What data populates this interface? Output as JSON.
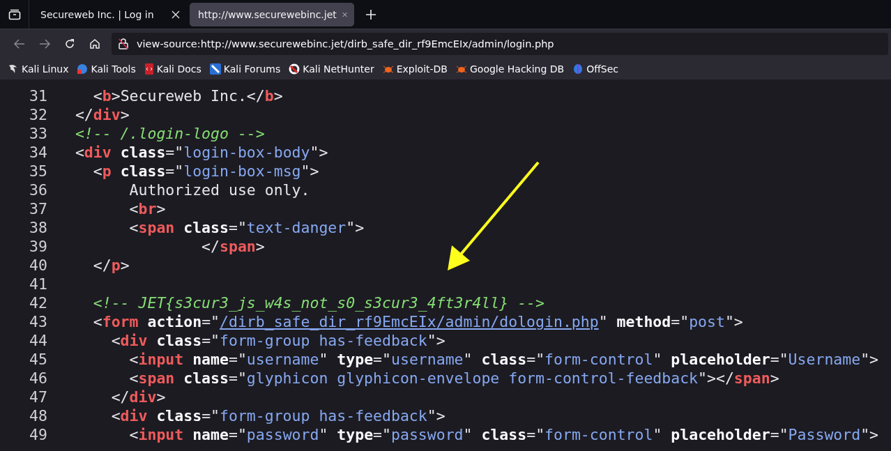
{
  "tabs": [
    {
      "title": "Secureweb Inc. | Log in",
      "selected": false
    },
    {
      "title": "http://www.securewebinc.jet",
      "selected": true
    }
  ],
  "address_bar": {
    "value": "view-source:http://www.securewebinc.jet/dirb_safe_dir_rf9EmcEIx/admin/login.php"
  },
  "bookmarks": [
    {
      "label": "Kali Linux",
      "kind": "dragon"
    },
    {
      "label": "Kali Tools",
      "kind": "tools"
    },
    {
      "label": "Kali Docs",
      "kind": "docs"
    },
    {
      "label": "Kali Forums",
      "kind": "forums"
    },
    {
      "label": "Kali NetHunter",
      "kind": "nethunter"
    },
    {
      "label": "Exploit-DB",
      "kind": "bug"
    },
    {
      "label": "Google Hacking DB",
      "kind": "bug"
    },
    {
      "label": "OffSec",
      "kind": "offsec"
    }
  ],
  "source_lines": [
    {
      "number": "31",
      "tokens": [
        {
          "kind": "plain",
          "text": "    <"
        },
        {
          "kind": "tag",
          "text": "b"
        },
        {
          "kind": "plain",
          "text": ">Secureweb Inc.</"
        },
        {
          "kind": "tag",
          "text": "b"
        },
        {
          "kind": "plain",
          "text": ">"
        }
      ]
    },
    {
      "number": "32",
      "tokens": [
        {
          "kind": "plain",
          "text": "  </"
        },
        {
          "kind": "tag",
          "text": "div"
        },
        {
          "kind": "plain",
          "text": ">"
        }
      ]
    },
    {
      "number": "33",
      "tokens": [
        {
          "kind": "comment",
          "text": "  <!-- /.login-logo -->"
        }
      ]
    },
    {
      "number": "34",
      "tokens": [
        {
          "kind": "plain",
          "text": "  <"
        },
        {
          "kind": "tag",
          "text": "div"
        },
        {
          "kind": "attr",
          "text": " class"
        },
        {
          "kind": "plain",
          "text": "=\""
        },
        {
          "kind": "value",
          "text": "login-box-body"
        },
        {
          "kind": "plain",
          "text": "\">"
        }
      ]
    },
    {
      "number": "35",
      "tokens": [
        {
          "kind": "plain",
          "text": "    <"
        },
        {
          "kind": "tag",
          "text": "p"
        },
        {
          "kind": "attr",
          "text": " class"
        },
        {
          "kind": "plain",
          "text": "=\""
        },
        {
          "kind": "value",
          "text": "login-box-msg"
        },
        {
          "kind": "plain",
          "text": "\">"
        }
      ]
    },
    {
      "number": "36",
      "tokens": [
        {
          "kind": "plain",
          "text": "        Authorized use only."
        }
      ]
    },
    {
      "number": "37",
      "tokens": [
        {
          "kind": "plain",
          "text": "        <"
        },
        {
          "kind": "tag",
          "text": "br"
        },
        {
          "kind": "plain",
          "text": ">"
        }
      ]
    },
    {
      "number": "38",
      "tokens": [
        {
          "kind": "plain",
          "text": "        <"
        },
        {
          "kind": "tag",
          "text": "span"
        },
        {
          "kind": "attr",
          "text": " class"
        },
        {
          "kind": "plain",
          "text": "=\""
        },
        {
          "kind": "value",
          "text": "text-danger"
        },
        {
          "kind": "plain",
          "text": "\">"
        }
      ]
    },
    {
      "number": "39",
      "tokens": [
        {
          "kind": "plain",
          "text": "                </"
        },
        {
          "kind": "tag",
          "text": "span"
        },
        {
          "kind": "plain",
          "text": ">"
        }
      ]
    },
    {
      "number": "40",
      "tokens": [
        {
          "kind": "plain",
          "text": "    </"
        },
        {
          "kind": "tag",
          "text": "p"
        },
        {
          "kind": "plain",
          "text": ">"
        }
      ]
    },
    {
      "number": "41"
    },
    {
      "number": "42",
      "tokens": [
        {
          "kind": "comment",
          "text": "    <!-- JET{s3cur3_js_w4s_not_s0_s3cur3_4ft3r4ll} -->"
        }
      ]
    },
    {
      "number": "43",
      "tokens": [
        {
          "kind": "plain",
          "text": "    <"
        },
        {
          "kind": "tag",
          "text": "form"
        },
        {
          "kind": "attr",
          "text": " action"
        },
        {
          "kind": "plain",
          "text": "=\""
        },
        {
          "kind": "link",
          "text": "/dirb_safe_dir_rf9EmcEIx/admin/dologin.php"
        },
        {
          "kind": "plain",
          "text": "\""
        },
        {
          "kind": "attr",
          "text": " method"
        },
        {
          "kind": "plain",
          "text": "=\""
        },
        {
          "kind": "value",
          "text": "post"
        },
        {
          "kind": "plain",
          "text": "\">"
        }
      ]
    },
    {
      "number": "44",
      "tokens": [
        {
          "kind": "plain",
          "text": "      <"
        },
        {
          "kind": "tag",
          "text": "div"
        },
        {
          "kind": "attr",
          "text": " class"
        },
        {
          "kind": "plain",
          "text": "=\""
        },
        {
          "kind": "value",
          "text": "form-group has-feedback"
        },
        {
          "kind": "plain",
          "text": "\">"
        }
      ]
    },
    {
      "number": "45",
      "tokens": [
        {
          "kind": "plain",
          "text": "        <"
        },
        {
          "kind": "tag",
          "text": "input"
        },
        {
          "kind": "attr",
          "text": " name"
        },
        {
          "kind": "plain",
          "text": "=\""
        },
        {
          "kind": "value",
          "text": "username"
        },
        {
          "kind": "plain",
          "text": "\""
        },
        {
          "kind": "attr",
          "text": " type"
        },
        {
          "kind": "plain",
          "text": "=\""
        },
        {
          "kind": "value",
          "text": "username"
        },
        {
          "kind": "plain",
          "text": "\""
        },
        {
          "kind": "attr",
          "text": " class"
        },
        {
          "kind": "plain",
          "text": "=\""
        },
        {
          "kind": "value",
          "text": "form-control"
        },
        {
          "kind": "plain",
          "text": "\""
        },
        {
          "kind": "attr",
          "text": " placeholder"
        },
        {
          "kind": "plain",
          "text": "=\""
        },
        {
          "kind": "value",
          "text": "Username"
        },
        {
          "kind": "plain",
          "text": "\">"
        }
      ]
    },
    {
      "number": "46",
      "tokens": [
        {
          "kind": "plain",
          "text": "        <"
        },
        {
          "kind": "tag",
          "text": "span"
        },
        {
          "kind": "attr",
          "text": " class"
        },
        {
          "kind": "plain",
          "text": "=\""
        },
        {
          "kind": "value",
          "text": "glyphicon glyphicon-envelope form-control-feedback"
        },
        {
          "kind": "plain",
          "text": "\"></"
        },
        {
          "kind": "tag",
          "text": "span"
        },
        {
          "kind": "plain",
          "text": ">"
        }
      ]
    },
    {
      "number": "47",
      "tokens": [
        {
          "kind": "plain",
          "text": "      </"
        },
        {
          "kind": "tag",
          "text": "div"
        },
        {
          "kind": "plain",
          "text": ">"
        }
      ]
    },
    {
      "number": "48",
      "tokens": [
        {
          "kind": "plain",
          "text": "      <"
        },
        {
          "kind": "tag",
          "text": "div"
        },
        {
          "kind": "attr",
          "text": " class"
        },
        {
          "kind": "plain",
          "text": "=\""
        },
        {
          "kind": "value",
          "text": "form-group has-feedback"
        },
        {
          "kind": "plain",
          "text": "\">"
        }
      ]
    },
    {
      "number": "49",
      "tokens": [
        {
          "kind": "plain",
          "text": "        <"
        },
        {
          "kind": "tag",
          "text": "input"
        },
        {
          "kind": "attr",
          "text": " name"
        },
        {
          "kind": "plain",
          "text": "=\""
        },
        {
          "kind": "value",
          "text": "password"
        },
        {
          "kind": "plain",
          "text": "\""
        },
        {
          "kind": "attr",
          "text": " type"
        },
        {
          "kind": "plain",
          "text": "=\""
        },
        {
          "kind": "value",
          "text": "password"
        },
        {
          "kind": "plain",
          "text": "\""
        },
        {
          "kind": "attr",
          "text": " class"
        },
        {
          "kind": "plain",
          "text": "=\""
        },
        {
          "kind": "value",
          "text": "form-control"
        },
        {
          "kind": "plain",
          "text": "\""
        },
        {
          "kind": "attr",
          "text": " placeholder"
        },
        {
          "kind": "plain",
          "text": "=\""
        },
        {
          "kind": "value",
          "text": "Password"
        },
        {
          "kind": "plain",
          "text": "\">"
        }
      ]
    }
  ]
}
